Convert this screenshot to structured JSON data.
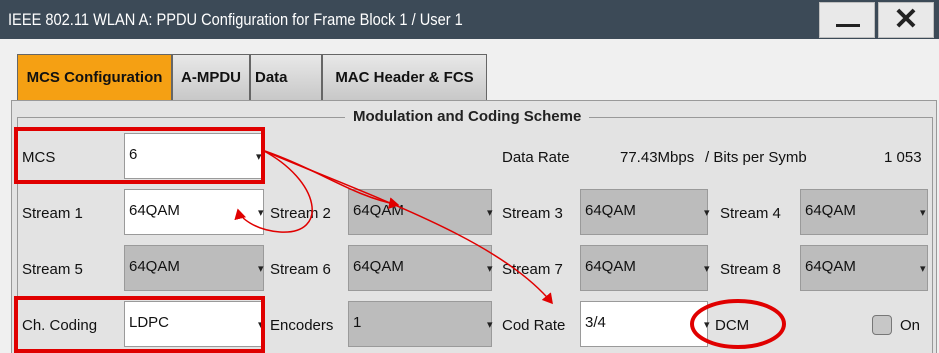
{
  "window": {
    "title": "IEEE 802.11 WLAN  A: PPDU Configuration for Frame Block 1 / User 1",
    "minimize_icon": "minimize-icon",
    "close_icon": "close-icon",
    "close_glyph": "✕"
  },
  "tabs": [
    {
      "label": "MCS Configuration",
      "active": true
    },
    {
      "label": "A-MPDU",
      "active": false
    },
    {
      "label": "Data",
      "active": false
    },
    {
      "label": "MAC Header & FCS",
      "active": false
    }
  ],
  "group": {
    "title": "Modulation and Coding Scheme"
  },
  "mcs": {
    "label": "MCS",
    "value": "6"
  },
  "data_rate": {
    "label": "Data Rate",
    "value": "77.43Mbps",
    "bits_label": "/ Bits per Symb",
    "bits_value": "1 053"
  },
  "streams": [
    {
      "label": "Stream 1",
      "value": "64QAM"
    },
    {
      "label": "Stream 2",
      "value": "64QAM"
    },
    {
      "label": "Stream 3",
      "value": "64QAM"
    },
    {
      "label": "Stream 4",
      "value": "64QAM"
    },
    {
      "label": "Stream 5",
      "value": "64QAM"
    },
    {
      "label": "Stream 6",
      "value": "64QAM"
    },
    {
      "label": "Stream 7",
      "value": "64QAM"
    },
    {
      "label": "Stream 8",
      "value": "64QAM"
    }
  ],
  "coding": {
    "label": "Ch. Coding",
    "value": "LDPC"
  },
  "encoders": {
    "label": "Encoders",
    "value": "1"
  },
  "cod_rate": {
    "label": "Cod Rate",
    "value": "3/4"
  },
  "dcm": {
    "label": "DCM",
    "state_label": "On",
    "checked": false
  },
  "colors": {
    "titlebar": "#3c4a57",
    "active_tab": "#f5a013",
    "highlight": "#e00000"
  }
}
